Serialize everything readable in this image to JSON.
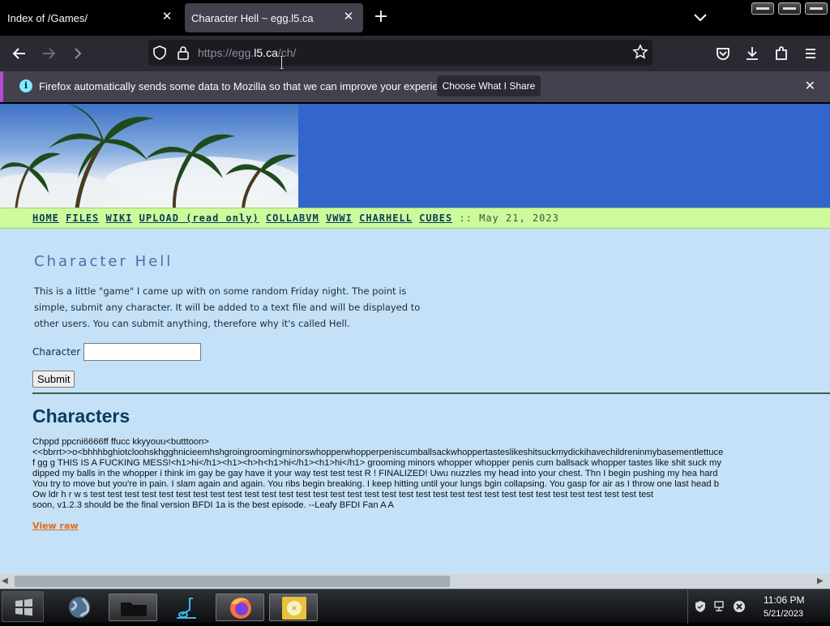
{
  "browser": {
    "tabs": [
      {
        "title": "Index of /Games/"
      },
      {
        "title": "Character Hell ~ egg.l5.ca"
      }
    ],
    "url": {
      "dim_prefix": "https://egg.",
      "host": "l5.ca",
      "path": "/ch/"
    },
    "infobar": {
      "message": "Firefox automatically sends some data to Mozilla so that we can improve your experience.",
      "button_label": "Choose What I Share"
    }
  },
  "site": {
    "nav": [
      "HOME",
      "FILES",
      "WIKI",
      "UPLOAD (read only)",
      "COLLABVM",
      "VWWI",
      "CHARHELL",
      "CUBES"
    ],
    "nav_date": ":: May 21, 2023",
    "heading": "Character Hell",
    "intro": "This is a little \"game\" I came up with on some random Friday night. The point is simple, submit any character. It will be added to a text file and will be displayed to other users. You can submit anything, therefore why it's called Hell.",
    "form": {
      "label": "Character",
      "input_value": "",
      "submit_label": "Submit"
    },
    "characters_heading": "Characters",
    "characters_lines": [
      "Chppd ppcni6666ff ffucc kkyyouu<butttoon>",
      "<<bbrrt>>o<bhhhbghiotcloohskhgghnicieemhshgroingroomingminorswhopperwhopperpeniscumballsackwhoppertasteslikeshitsuckmydickihavechildreninmybasementlettuce",
      "f gg g THIS IS A FUCKING MESS!<h1>hi</h1><h1><h>h<h1>hi</h1><h1>hi</h1> grooming minors whopper whopper penis cum ballsack whopper tastes like shit suck my",
      "dipped my balls in the whopper i think im gay be gay have it your way test test test R ! FINALIZED! Uwu nuzzles my head into your chest. Thn I begin pushing my hea hard",
      "You try to move but you're in pain. I slam again and again. You ribs begin breaking. I keep hitting until your lungs bgin collapsing. You gasp for air as I throw one last head b",
      "Ow ldr h r w s test test test test test test test test test test test test test test test test test test test test test test test test test test test test test test test test test",
      "soon, v1.2.3 should be the final version BFDI 1a is the best episode. --Leafy BFDI Fan A A"
    ],
    "view_raw_label": "View raw"
  },
  "taskbar": {
    "apps": [
      "globe-icon",
      "folder-icon",
      "music-icon",
      "firefox-icon",
      "disc-icon"
    ],
    "clock_time": "11:06 PM",
    "clock_date": "5/21/2023"
  },
  "colors": {
    "accent_infobar": "#b44bd0",
    "page_bg": "#c4e1f7",
    "nav_strip": "#cdfb9c",
    "link_orange": "#e36a1a",
    "heading_blue": "#0d3b5c"
  }
}
